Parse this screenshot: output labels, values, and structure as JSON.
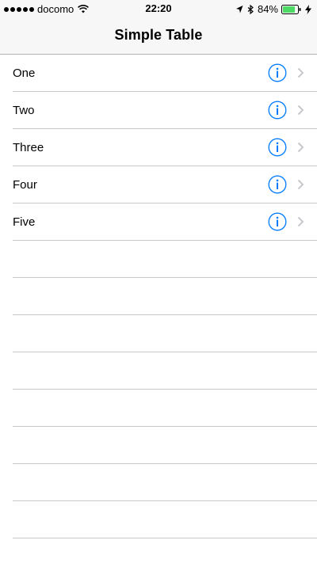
{
  "status_bar": {
    "carrier": "docomo",
    "time": "22:20",
    "battery_percent": "84%",
    "battery_level": 0.84,
    "icons": [
      "signal-dots-icon",
      "wifi-icon",
      "location-arrow-icon",
      "bluetooth-icon",
      "battery-icon",
      "charging-icon"
    ]
  },
  "nav": {
    "title": "Simple Table"
  },
  "table": {
    "rows": [
      {
        "label": "One"
      },
      {
        "label": "Two"
      },
      {
        "label": "Three"
      },
      {
        "label": "Four"
      },
      {
        "label": "Five"
      }
    ],
    "accessory_icons": [
      "info-icon",
      "chevron-right-icon"
    ]
  },
  "colors": {
    "accent": "#007aff",
    "chevron": "#c7c7cc",
    "separator": "#c8c7cc",
    "bar_background": "#f7f7f7",
    "battery_fill": "#4cd964"
  }
}
